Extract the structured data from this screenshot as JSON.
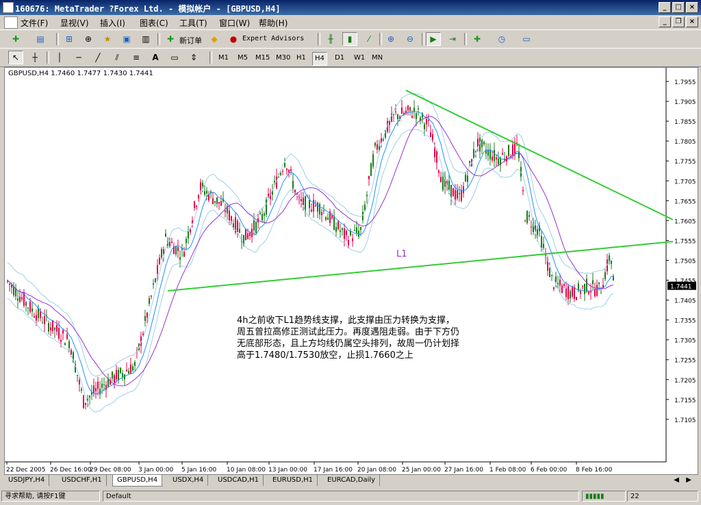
{
  "window": {
    "title": "160676: MetaTrader ?Forex Ltd. - 模拟帐户 - [GBPUSD,H4]"
  },
  "menu": [
    "文件(F)",
    "显视(V)",
    "插入(I)",
    "图表(C)",
    "工具(T)",
    "窗口(W)",
    "帮助(H)"
  ],
  "toolbar": {
    "new_order": "新订单",
    "expert_advisors": "Expert Advisors"
  },
  "timeframes": [
    "M1",
    "M5",
    "M15",
    "M30",
    "H1",
    "H4",
    "D1",
    "W1",
    "MN"
  ],
  "active_timeframe": "H4",
  "chart": {
    "header": "GBPUSD,H4  1.7460 1.7477 1.7430 1.7441",
    "price_labels": [
      "1.7955",
      "1.7905",
      "1.7855",
      "1.7805",
      "1.7755",
      "1.7705",
      "1.7655",
      "1.7605",
      "1.7555",
      "1.7505",
      "1.7455",
      "1.7405",
      "1.7355",
      "1.7305",
      "1.7255",
      "1.7205",
      "1.7155",
      "1.7105"
    ],
    "current_price": "1.7441",
    "time_labels": [
      "22 Dec 2005",
      "26 Dec 16:00",
      "29 Dec 08:00",
      "3 Jan 00:00",
      "5 Jan 16:00",
      "10 Jan 08:00",
      "13 Jan 00:00",
      "17 Jan 16:00",
      "20 Jan 08:00",
      "25 Jan 00:00",
      "27 Jan 16:00",
      "1 Feb 08:00",
      "6 Feb 00:00",
      "8 Feb 16:00"
    ],
    "trendline_label": "L1",
    "annotation": "4h之前收下L1趋势线支撑，此支撑由压力转换为支撑，周五曾拉高修正测试此压力。再度遇阻走弱。由于下方仍无底部形态，且上方均线仍属空头排列，故周一仍计划择高于1.7480/1.7530放空，止损1.7660之上",
    "colors": {
      "bull": "#e0004a",
      "bear": "#1a7a1a",
      "trend": "#32cd32",
      "ma_fast": "#1e90ff",
      "ma_slow": "#9932cc",
      "bands": "#9ecfe8"
    }
  },
  "tabs": [
    "USDJPY,H4",
    "USDCHF,H1",
    "GBPUSD,H4",
    "USDX,H4",
    "USDCAD,H1",
    "EURUSD,H1",
    "EURCAD,Daily"
  ],
  "active_tab": "GBPUSD,H4",
  "status": {
    "help": "寻求帮助, 请按F1键",
    "profile": "Default",
    "right": "22"
  }
}
